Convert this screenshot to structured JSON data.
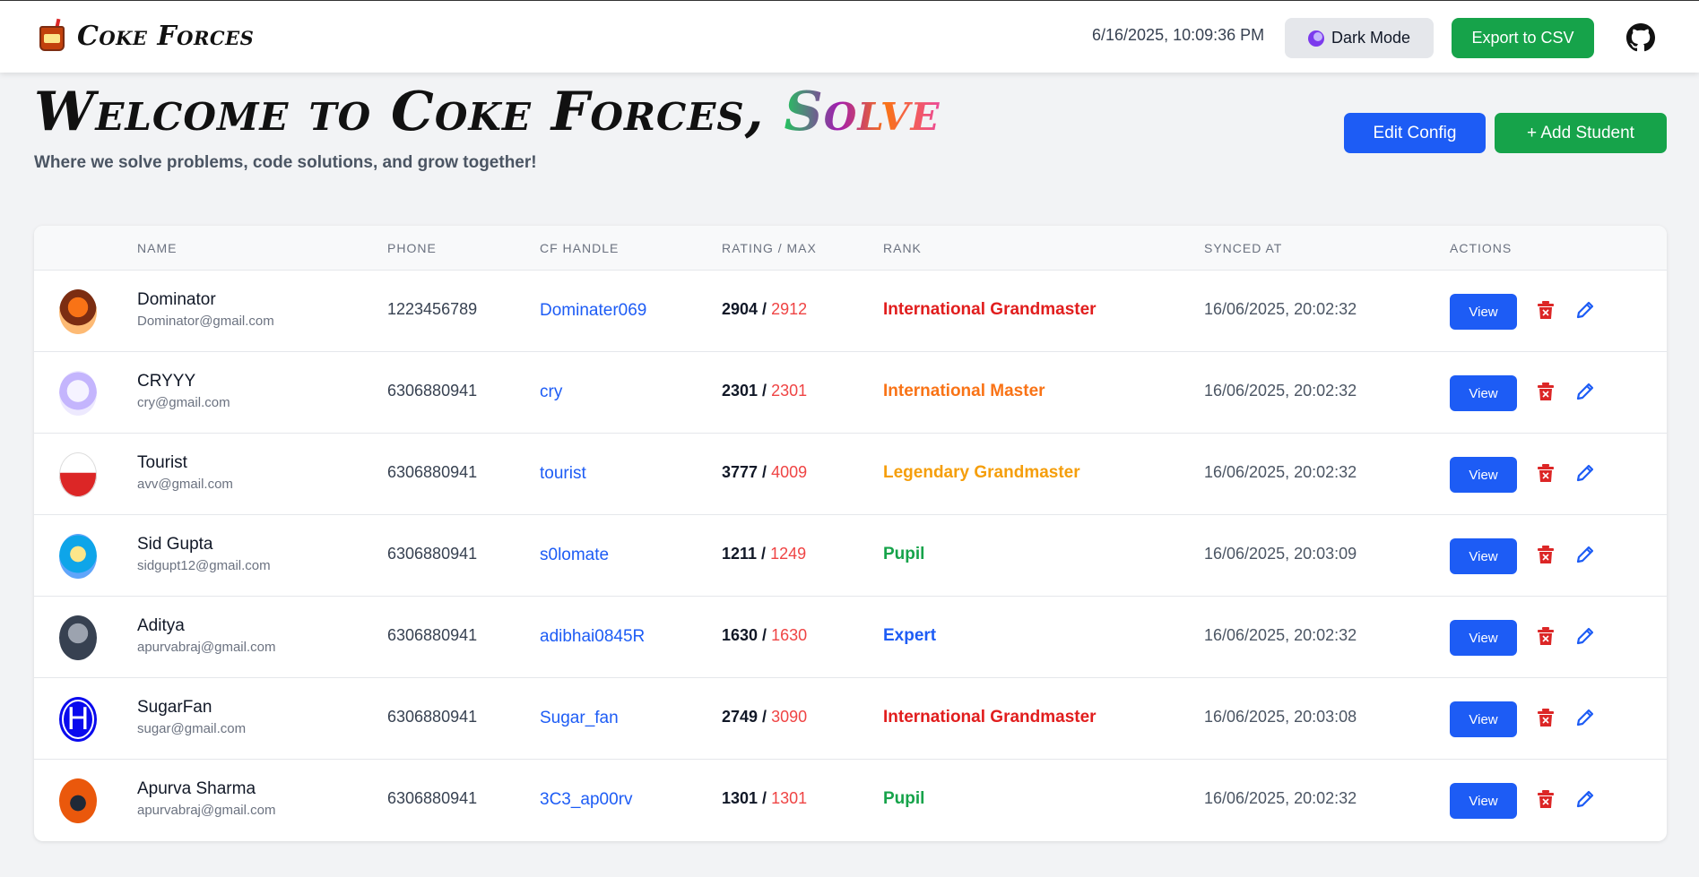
{
  "app": {
    "brand": "Coke Forces",
    "clock": "6/16/2025, 10:09:36 PM",
    "dark_mode_label": "Dark Mode",
    "export_label": "Export to CSV"
  },
  "header": {
    "welcome": "Welcome to Coke Forces,",
    "highlight": "Solve",
    "tagline": "Where we solve problems, code solutions, and grow together!",
    "edit_config_label": "Edit Config",
    "add_student_label": "+ Add Student"
  },
  "table": {
    "columns": {
      "name": "NAME",
      "phone": "PHONE",
      "handle": "CF HANDLE",
      "rating": "RATING / MAX",
      "rank": "RANK",
      "synced": "SYNCED AT",
      "actions": "ACTIONS"
    },
    "view_label": "View",
    "rows": [
      {
        "name": "Dominator",
        "email": "Dominator@gmail.com",
        "phone": "1223456789",
        "handle": "Dominater069",
        "rating": "2904 /",
        "max": "2912",
        "rank": "International Grandmaster",
        "rank_color": "#e11d1d",
        "synced": "16/06/2025, 20:02:32",
        "avatar": "red-panda-avatar"
      },
      {
        "name": "CRYYY",
        "email": "cry@gmail.com",
        "phone": "6306880941",
        "handle": "cry",
        "rating": "2301 /",
        "max": "2301",
        "rank": "International Master",
        "rank_color": "#f97316",
        "synced": "16/06/2025, 20:02:32",
        "avatar": "anime-girl-avatar"
      },
      {
        "name": "Tourist",
        "email": "avv@gmail.com",
        "phone": "6306880941",
        "handle": "tourist",
        "rating": "3777 /",
        "max": "4009",
        "rank": "Legendary Grandmaster",
        "rank_color": "#f59e0b",
        "synced": "16/06/2025, 20:02:32",
        "avatar": "person-avatar"
      },
      {
        "name": "Sid Gupta",
        "email": "sidgupt12@gmail.com",
        "phone": "6306880941",
        "handle": "s0lomate",
        "rating": "1211 /",
        "max": "1249",
        "rank": "Pupil",
        "rank_color": "#16a34a",
        "synced": "16/06/2025, 20:03:09",
        "avatar": "anime-blue-avatar"
      },
      {
        "name": "Aditya",
        "email": "apurvabraj@gmail.com",
        "phone": "6306880941",
        "handle": "adibhai0845R",
        "rating": "1630 /",
        "max": "1630",
        "rank": "Expert",
        "rank_color": "#1d5cf5",
        "synced": "16/06/2025, 20:02:32",
        "avatar": "dark-figure-avatar"
      },
      {
        "name": "SugarFan",
        "email": "sugar@gmail.com",
        "phone": "6306880941",
        "handle": "Sugar_fan",
        "rating": "2749 /",
        "max": "3090",
        "rank": "International Grandmaster",
        "rank_color": "#e11d1d",
        "synced": "16/06/2025, 20:03:08",
        "avatar": "letter-h-avatar",
        "avatar_letter": "H"
      },
      {
        "name": "Apurva Sharma",
        "email": "apurvabraj@gmail.com",
        "phone": "6306880941",
        "handle": "3C3_ap00rv",
        "rating": "1301 /",
        "max": "1301",
        "rank": "Pupil",
        "rank_color": "#16a34a",
        "synced": "16/06/2025, 20:02:32",
        "avatar": "orange-silhouette-avatar"
      }
    ]
  }
}
